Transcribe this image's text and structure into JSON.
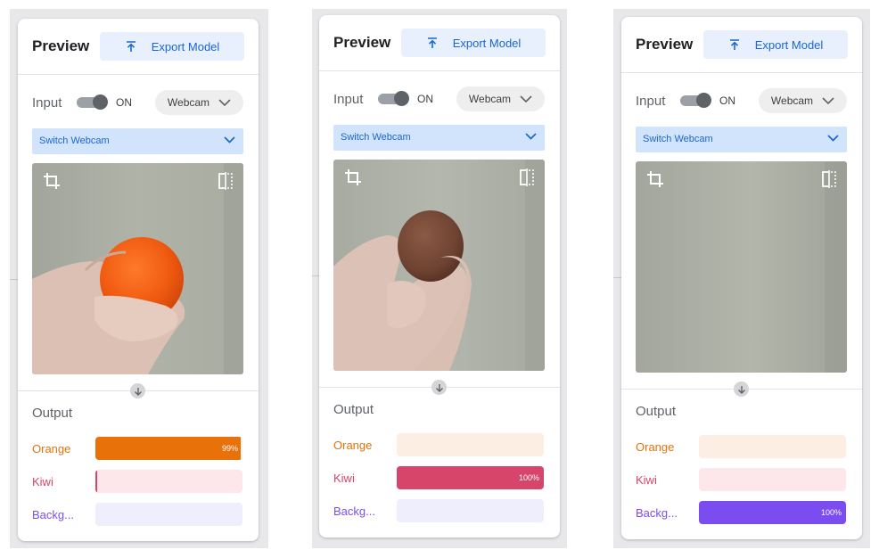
{
  "colors": {
    "orange": "#e8710a",
    "orange_bg": "#fdeee4",
    "kiwi": "#d7456a",
    "kiwi_bg": "#fde7ea",
    "background": "#7b4cf0",
    "background_bg": "#eeeefd",
    "accent": "#1967d2"
  },
  "panels": [
    {
      "title": "Preview",
      "export_label": "Export Model",
      "input_label": "Input",
      "toggle_state": "ON",
      "source": "Webcam",
      "switch_label": "Switch Webcam",
      "camera_subject": "orange-fruit",
      "output_label": "Output",
      "classes": [
        {
          "name": "Orange",
          "value": 0.99,
          "pct": "99%"
        },
        {
          "name": "Kiwi",
          "value": 0.01,
          "pct": ""
        },
        {
          "name": "Backg...",
          "value": 0.0,
          "pct": ""
        }
      ]
    },
    {
      "title": "Preview",
      "export_label": "Export Model",
      "input_label": "Input",
      "toggle_state": "ON",
      "source": "Webcam",
      "switch_label": "Switch Webcam",
      "camera_subject": "kiwi-fruit",
      "output_label": "Output",
      "classes": [
        {
          "name": "Orange",
          "value": 0.0,
          "pct": ""
        },
        {
          "name": "Kiwi",
          "value": 1.0,
          "pct": "100%"
        },
        {
          "name": "Backg...",
          "value": 0.0,
          "pct": ""
        }
      ]
    },
    {
      "title": "Preview",
      "export_label": "Export Model",
      "input_label": "Input",
      "toggle_state": "ON",
      "source": "Webcam",
      "switch_label": "Switch Webcam",
      "camera_subject": "empty-background",
      "output_label": "Output",
      "classes": [
        {
          "name": "Orange",
          "value": 0.0,
          "pct": ""
        },
        {
          "name": "Kiwi",
          "value": 0.0,
          "pct": ""
        },
        {
          "name": "Backg...",
          "value": 1.0,
          "pct": "100%"
        }
      ]
    }
  ]
}
